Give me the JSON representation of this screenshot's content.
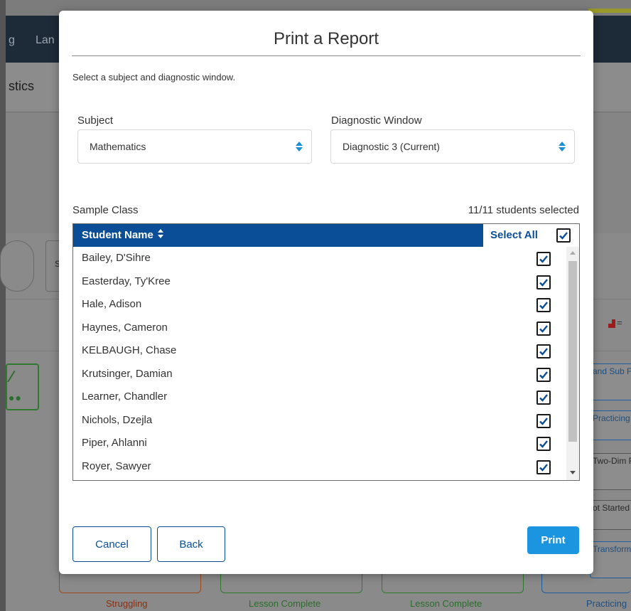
{
  "background": {
    "nav_items": [
      "g",
      "Lan"
    ],
    "section_title": "stics",
    "filter_fragment": "s",
    "right_cards": [
      "and Sub Facts",
      "Practicing",
      "Two-Dim Figures",
      "ot Started",
      "Transform"
    ],
    "bottom_labels": [
      "Struggling",
      "Lesson Complete",
      "Lesson Complete",
      "Practicing"
    ]
  },
  "modal": {
    "title": "Print a Report",
    "instructions": "Select a subject and diagnostic window.",
    "subject": {
      "label": "Subject",
      "value": "Mathematics"
    },
    "diagnostic_window": {
      "label": "Diagnostic Window",
      "value": "Diagnostic 3 (Current)"
    },
    "class_name": "Sample Class",
    "selected_count": "11/11 students selected",
    "table": {
      "header_name": "Student Name",
      "select_all_label": "Select All",
      "select_all_checked": true,
      "students": [
        {
          "name": "Bailey, D'Sihre",
          "checked": true
        },
        {
          "name": "Easterday, Ty'Kree",
          "checked": true
        },
        {
          "name": "Hale, Adison",
          "checked": true
        },
        {
          "name": "Haynes, Cameron",
          "checked": true
        },
        {
          "name": "KELBAUGH, Chase",
          "checked": true
        },
        {
          "name": "Krutsinger, Damian",
          "checked": true
        },
        {
          "name": "Learner, Chandler",
          "checked": true
        },
        {
          "name": "Nichols, Dzejla",
          "checked": true
        },
        {
          "name": "Piper, Ahlanni",
          "checked": true
        },
        {
          "name": "Royer, Sawyer",
          "checked": true
        }
      ]
    },
    "buttons": {
      "cancel": "Cancel",
      "back": "Back",
      "print": "Print"
    }
  },
  "colors": {
    "header_blue": "#0a4e98",
    "accent_blue": "#1b95df"
  }
}
